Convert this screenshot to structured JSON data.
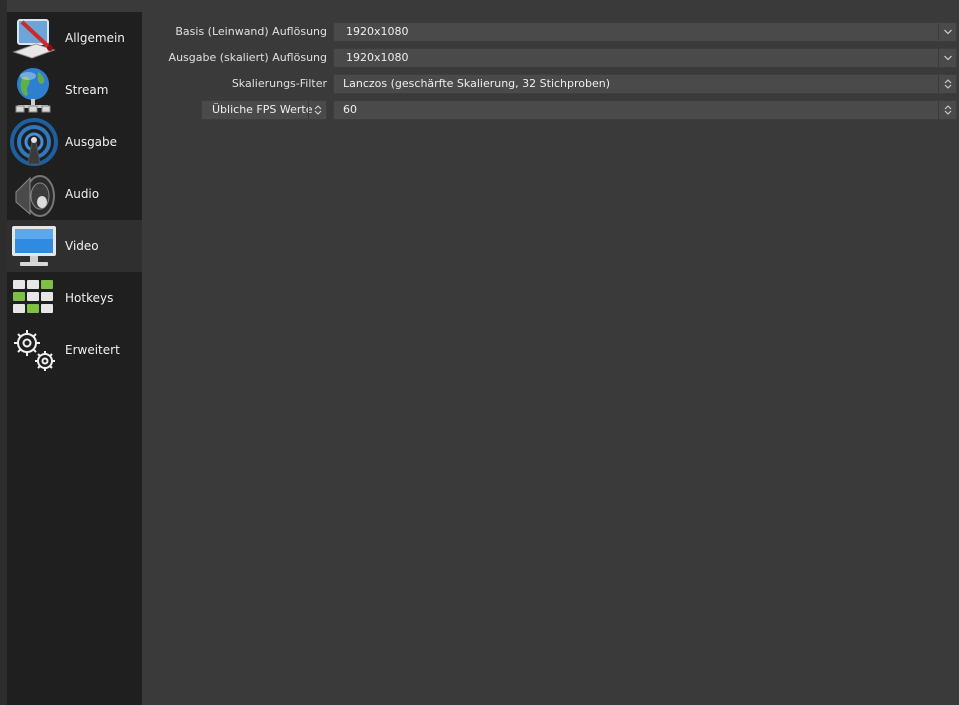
{
  "sidebar": {
    "items": [
      {
        "label": "Allgemein",
        "icon": "general-settings-icon"
      },
      {
        "label": "Stream",
        "icon": "globe-network-icon"
      },
      {
        "label": "Ausgabe",
        "icon": "broadcast-antenna-icon"
      },
      {
        "label": "Audio",
        "icon": "speaker-icon"
      },
      {
        "label": "Video",
        "icon": "monitor-icon"
      },
      {
        "label": "Hotkeys",
        "icon": "keyboard-icon"
      },
      {
        "label": "Erweitert",
        "icon": "gears-icon"
      }
    ],
    "active": "Video"
  },
  "video": {
    "base_resolution": {
      "label": "Basis (Leinwand) Auflösung",
      "value": "1920x1080"
    },
    "output_resolution": {
      "label": "Ausgabe (skaliert) Auflösung",
      "value": "1920x1080"
    },
    "downscale_filter": {
      "label": "Skalierungs-Filter",
      "value": "Lanczos (geschärfte Skalierung, 32 Stichproben)"
    },
    "fps": {
      "type_label": "Übliche FPS Werte",
      "value": "60"
    }
  },
  "colors": {
    "background": "#3a3a3a",
    "sidebar": "#1f1f1f",
    "active_item": "#2f2f2f",
    "combo": "#4a4a4a"
  }
}
